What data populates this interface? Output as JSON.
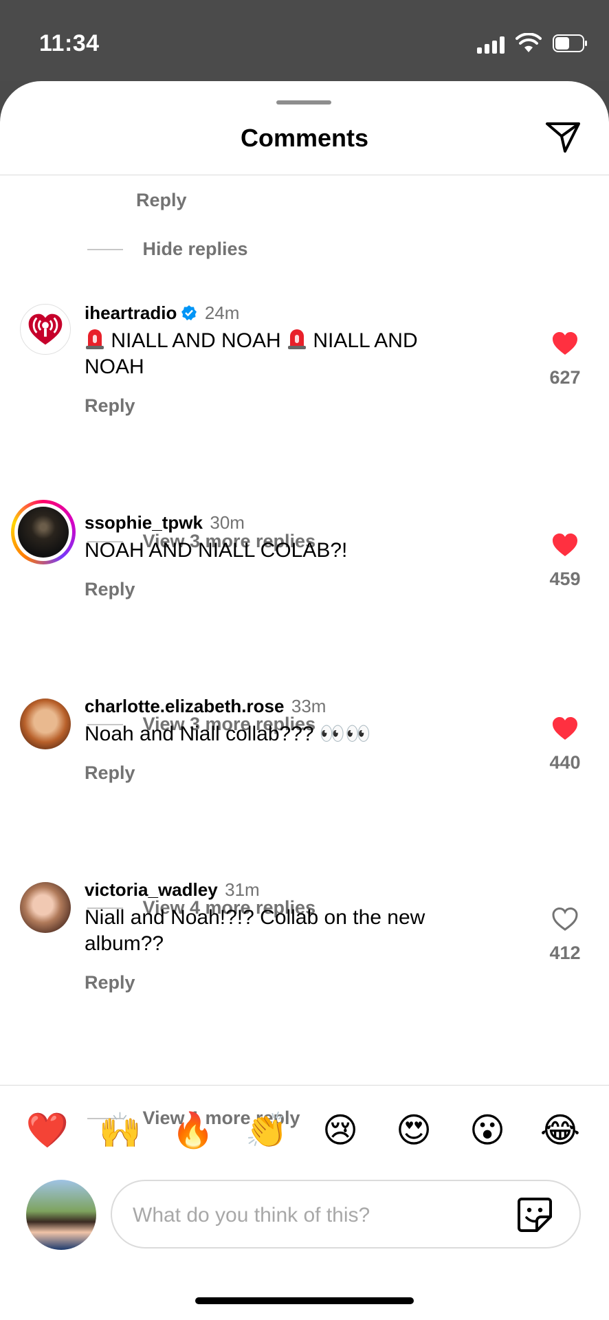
{
  "status_bar": {
    "time": "11:34"
  },
  "header": {
    "title": "Comments"
  },
  "previous_thread": {
    "reply_label": "Reply",
    "hide_replies_label": "Hide replies"
  },
  "comments": [
    {
      "username": "iheartradio",
      "verified": true,
      "time": "24m",
      "text_part1": "NIALL AND NOAH ",
      "text_part2": "NIALL AND NOAH",
      "reply_label": "Reply",
      "likes": "627",
      "liked": true,
      "more_replies": "View 3 more replies"
    },
    {
      "username": "ssophie_tpwk",
      "time": "30m",
      "text": "NOAH AND NIALL COLAB?!",
      "reply_label": "Reply",
      "likes": "459",
      "liked": true,
      "more_replies": "View 3 more replies"
    },
    {
      "username": "charlotte.elizabeth.rose",
      "time": "33m",
      "text": "Noah and Niall collab??? 👀👀",
      "reply_label": "Reply",
      "likes": "440",
      "liked": true,
      "more_replies": "View 4 more replies"
    },
    {
      "username": "victoria_wadley",
      "time": "31m",
      "text": "Niall and Noah!?!? Collab on the new album??",
      "reply_label": "Reply",
      "likes": "412",
      "liked": false,
      "more_replies": "View 1 more reply"
    }
  ],
  "quick_reactions": [
    "❤️",
    "🙌",
    "🔥",
    "👏",
    "😢",
    "😍",
    "😮",
    "😂"
  ],
  "composer": {
    "placeholder": "What do you think of this?"
  },
  "colors": {
    "like_red": "#ff3040",
    "verified_blue": "#0095f6",
    "muted": "#737373"
  }
}
